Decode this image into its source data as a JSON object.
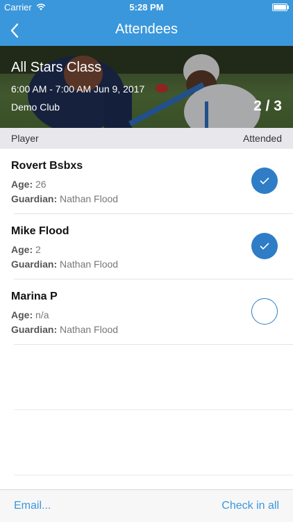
{
  "status_bar": {
    "carrier": "Carrier",
    "time": "5:28 PM"
  },
  "nav": {
    "title": "Attendees",
    "back_icon": "chevron-left-icon"
  },
  "hero": {
    "title": "All Stars Class",
    "time_date": "6:00 AM - 7:00 AM  Jun 9, 2017",
    "club": "Demo Club",
    "count": "2 / 3"
  },
  "columns": {
    "player": "Player",
    "attended": "Attended"
  },
  "attendees": [
    {
      "name": "Rovert Bsbxs",
      "age_label": "Age:",
      "age": "26",
      "guardian_label": "Guardian:",
      "guardian": "Nathan Flood",
      "attended": true
    },
    {
      "name": "Mike Flood",
      "age_label": "Age:",
      "age": "2",
      "guardian_label": "Guardian:",
      "guardian": "Nathan Flood",
      "attended": true
    },
    {
      "name": "Marina P",
      "age_label": "Age:",
      "age": "n/a",
      "guardian_label": "Guardian:",
      "guardian": "Nathan Flood",
      "attended": false
    }
  ],
  "footer": {
    "email_label": "Email...",
    "checkin_label": "Check in all"
  },
  "colors": {
    "accent": "#3a97db",
    "check_fill": "#2e7dc6"
  }
}
